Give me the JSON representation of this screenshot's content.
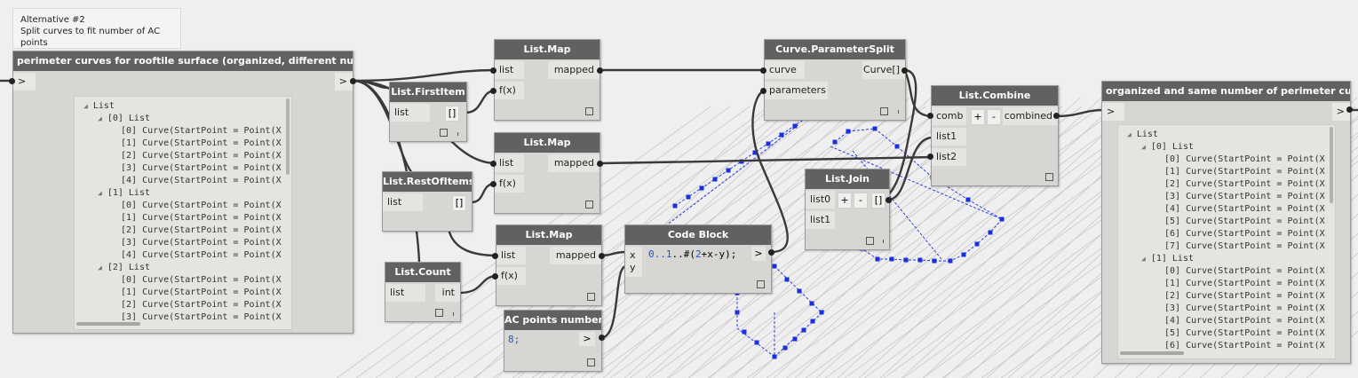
{
  "note": {
    "title": "Alternative #2",
    "description": "Split curves to fit number of AC points"
  },
  "nodes": {
    "watch_in": {
      "title": "perimeter curves for rooftile surface (organized, different numbers)",
      "in_arrow": ">",
      "out_arrow": ">"
    },
    "first_item": {
      "title": "List.FirstItem",
      "in_list": "list",
      "out": "[]"
    },
    "rest_of_items": {
      "title": "List.RestOfItems",
      "in_list": "list",
      "out": "[]"
    },
    "list_count": {
      "title": "List.Count",
      "in_list": "list",
      "out": "int"
    },
    "map1": {
      "title": "List.Map",
      "in_list": "list",
      "in_fx": "f(x)",
      "out": "mapped"
    },
    "map2": {
      "title": "List.Map",
      "in_list": "list",
      "in_fx": "f(x)",
      "out": "mapped"
    },
    "map3": {
      "title": "List.Map",
      "in_list": "list",
      "in_fx": "f(x)",
      "out": "mapped"
    },
    "ac_points": {
      "title": "AC points number",
      "code": "8;",
      "out": ">"
    },
    "code_block": {
      "title": "Code Block",
      "in_x": "x",
      "in_y": "y",
      "code_a": "0..",
      "code_b": "1",
      "code_c": "..#(",
      "code_d": "2",
      "code_e": "+x-y);",
      "out": ">"
    },
    "param_split": {
      "title": "Curve.ParameterSplit",
      "in_curve": "curve",
      "in_params": "parameters",
      "out": "Curve[]"
    },
    "list_join": {
      "title": "List.Join",
      "in_list0": "list0",
      "in_list1": "list1",
      "plus": "+",
      "minus": "-",
      "out": "[]"
    },
    "list_combine": {
      "title": "List.Combine",
      "in_comb": "comb",
      "in_list1": "list1",
      "in_list2": "list2",
      "plus": "+",
      "minus": "-",
      "out": "combined"
    },
    "watch_out": {
      "title": "organized and same number of perimeter curves",
      "in_arrow": ">",
      "out_arrow": ">"
    }
  },
  "watch_in_lines": [
    {
      "t": "List",
      "lvl": 0,
      "tri": true
    },
    {
      "t": "[0] List",
      "lvl": 1,
      "tri": true
    },
    {
      "t": "[0] Curve(StartPoint = Point(X",
      "lvl": 2
    },
    {
      "t": "[1] Curve(StartPoint = Point(X",
      "lvl": 2
    },
    {
      "t": "[2] Curve(StartPoint = Point(X",
      "lvl": 2
    },
    {
      "t": "[3] Curve(StartPoint = Point(X",
      "lvl": 2
    },
    {
      "t": "[4] Curve(StartPoint = Point(X",
      "lvl": 2
    },
    {
      "t": "[1] List",
      "lvl": 1,
      "tri": true
    },
    {
      "t": "[0] Curve(StartPoint = Point(X",
      "lvl": 2
    },
    {
      "t": "[1] Curve(StartPoint = Point(X",
      "lvl": 2
    },
    {
      "t": "[2] Curve(StartPoint = Point(X",
      "lvl": 2
    },
    {
      "t": "[3] Curve(StartPoint = Point(X",
      "lvl": 2
    },
    {
      "t": "[4] Curve(StartPoint = Point(X",
      "lvl": 2
    },
    {
      "t": "[2] List",
      "lvl": 1,
      "tri": true
    },
    {
      "t": "[0] Curve(StartPoint = Point(X",
      "lvl": 2
    },
    {
      "t": "[1] Curve(StartPoint = Point(X",
      "lvl": 2
    },
    {
      "t": "[2] Curve(StartPoint = Point(X",
      "lvl": 2
    },
    {
      "t": "[3] Curve(StartPoint = Point(X",
      "lvl": 2
    }
  ],
  "watch_out_lines": [
    {
      "t": "List",
      "lvl": 0,
      "tri": true
    },
    {
      "t": "[0] List",
      "lvl": 1,
      "tri": true
    },
    {
      "t": "[0] Curve(StartPoint = Point(X",
      "lvl": 2
    },
    {
      "t": "[1] Curve(StartPoint = Point(X",
      "lvl": 2
    },
    {
      "t": "[2] Curve(StartPoint = Point(X",
      "lvl": 2
    },
    {
      "t": "[3] Curve(StartPoint = Point(X",
      "lvl": 2
    },
    {
      "t": "[4] Curve(StartPoint = Point(X",
      "lvl": 2
    },
    {
      "t": "[5] Curve(StartPoint = Point(X",
      "lvl": 2
    },
    {
      "t": "[6] Curve(StartPoint = Point(X",
      "lvl": 2
    },
    {
      "t": "[7] Curve(StartPoint = Point(X",
      "lvl": 2
    },
    {
      "t": "[1] List",
      "lvl": 1,
      "tri": true
    },
    {
      "t": "[0] Curve(StartPoint = Point(X",
      "lvl": 2
    },
    {
      "t": "[1] Curve(StartPoint = Point(X",
      "lvl": 2
    },
    {
      "t": "[2] Curve(StartPoint = Point(X",
      "lvl": 2
    },
    {
      "t": "[3] Curve(StartPoint = Point(X",
      "lvl": 2
    },
    {
      "t": "[4] Curve(StartPoint = Point(X",
      "lvl": 2
    },
    {
      "t": "[5] Curve(StartPoint = Point(X",
      "lvl": 2
    },
    {
      "t": "[6] Curve(StartPoint = Point(X",
      "lvl": 2
    }
  ],
  "colors": {
    "canvas": "#efefef",
    "node_header": "#616161",
    "node_body": "#d8d6d2",
    "wire": "#3a3a3a",
    "geometry": "#1a2fe0",
    "grid": "#c9c9c9"
  }
}
